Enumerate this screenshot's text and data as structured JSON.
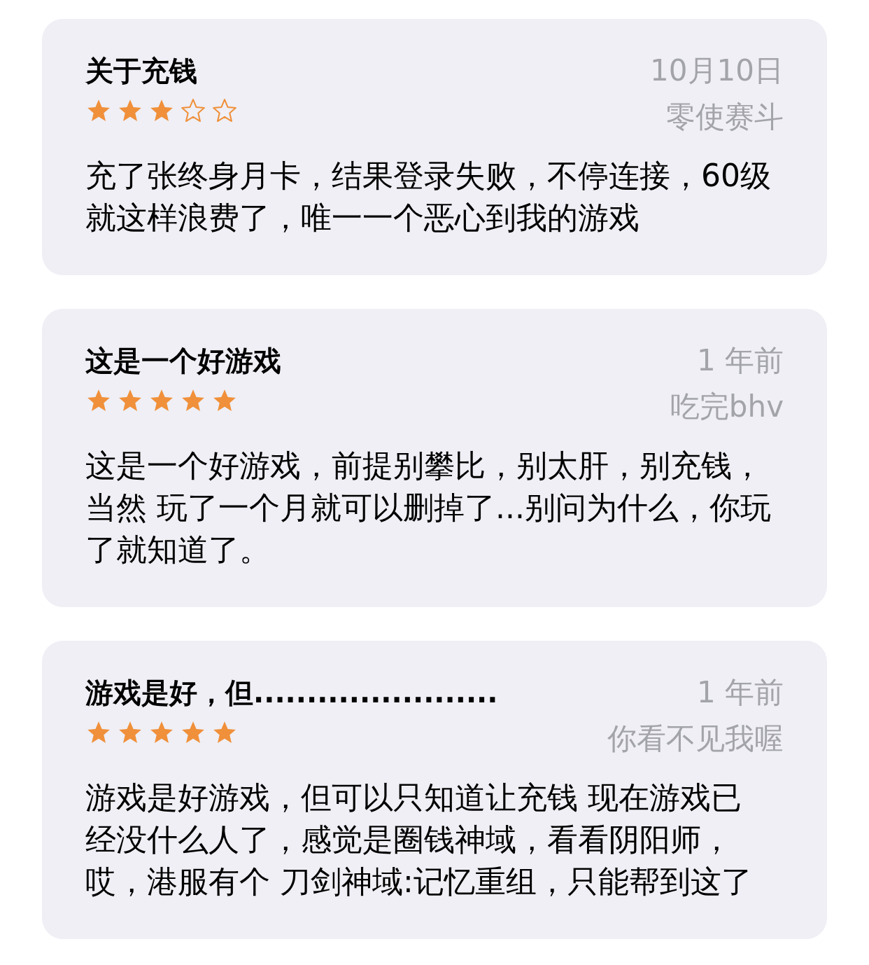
{
  "reviews": [
    {
      "title": "关于充钱",
      "stars": 3,
      "date": "10月10日",
      "author": "零使赛斗",
      "body": "充了张终身月卡，结果登录失败，不停连接，60级就这样浪费了，唯一一个恶心到我的游戏"
    },
    {
      "title": "这是一个好游戏",
      "stars": 5,
      "date": "1 年前",
      "author": "吃完bhv",
      "body": "这是一个好游戏，前提别攀比，别太肝，别充钱，当然 玩了一个月就可以删掉了...别问为什么，你玩了就知道了。"
    },
    {
      "title": "游戏是好，但.......................",
      "stars": 5,
      "date": "1 年前",
      "author": "你看不见我喔",
      "body": "游戏是好游戏，但可以只知道让充钱 现在游戏已经没什么人了，感觉是圈钱神域，看看阴阳师，哎，港服有个 刀剑神域:记忆重组，只能帮到这了"
    }
  ]
}
